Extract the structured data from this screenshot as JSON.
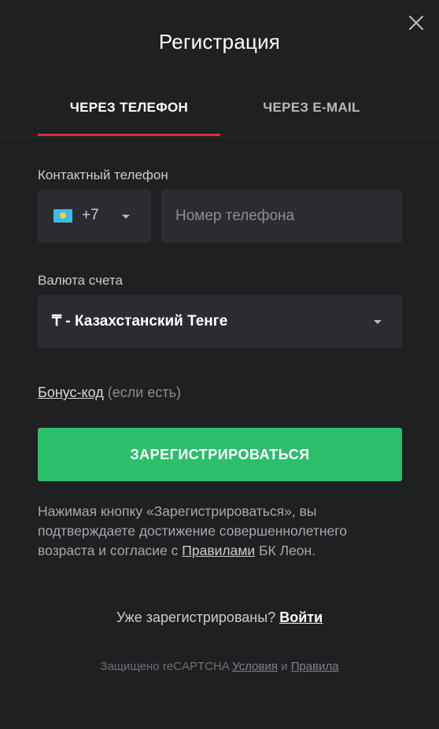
{
  "title": "Регистрация",
  "tabs": [
    {
      "label": "ЧЕРЕЗ ТЕЛЕФОН"
    },
    {
      "label": "ЧЕРЕЗ E-MAIL"
    }
  ],
  "colors": {
    "accent_tab": "#e02c2c",
    "primary_button": "#2dbe6c",
    "background": "#1e2022",
    "field_background": "#2a2c2f"
  },
  "phone": {
    "label": "Контактный телефон",
    "country_code": "+7",
    "flag_icon": "kazakhstan-flag",
    "placeholder": "Номер телефона",
    "value": ""
  },
  "currency": {
    "label": "Валюта счета",
    "selected": "₸ - Казахстанский Тенге"
  },
  "bonus": {
    "link": "Бонус-код",
    "hint": "(если есть)"
  },
  "register_button": "ЗАРЕГИСТРИРОВАТЬСЯ",
  "terms": {
    "text_before": "Нажимая кнопку «Зарегистрироваться», вы подтверждаете достижение совершеннолетнего возраста и согласие с",
    "link": "Правилами",
    "text_after": "БК Леон."
  },
  "login": {
    "question": "Уже зарегистрированы?",
    "link": "Войти"
  },
  "recaptcha": {
    "prefix": "Защищено reCAPTCHA",
    "terms_link": "Условия",
    "and": "и",
    "rules_link": "Правила"
  }
}
